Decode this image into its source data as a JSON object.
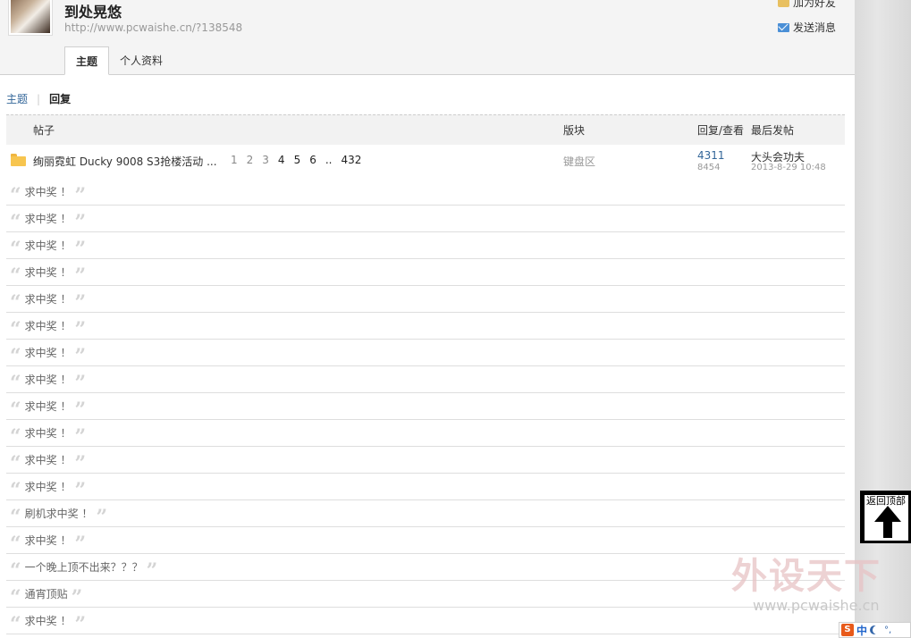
{
  "profile": {
    "username": "到处晃悠",
    "url": "http://www.pcwaishe.cn/?138548",
    "actions": {
      "add_friend": "加为好友",
      "send_message": "发送消息"
    }
  },
  "tabs": [
    {
      "label": "主题",
      "active": true
    },
    {
      "label": "个人资料",
      "active": false
    }
  ],
  "subnav": {
    "topics": "主题",
    "replies": "回复"
  },
  "table": {
    "headers": {
      "post": "帖子",
      "forum": "版块",
      "stats": "回复/查看",
      "last": "最后发帖"
    },
    "thread": {
      "title": "绚丽霓虹 Ducky 9008 S3抢楼活动 ...",
      "pages": [
        "1",
        "2",
        "3",
        "4",
        "5",
        "6",
        "..",
        "432"
      ],
      "forum": "键盘区",
      "replies": "4311",
      "views": "8454",
      "last_poster": "大头会功夫",
      "last_date": "2013-8-29 10:48"
    },
    "reply_rows": [
      "求中奖 ！",
      "求中奖 ！",
      "求中奖 ！",
      "求中奖 ！",
      "求中奖 ！",
      "求中奖 ！",
      "求中奖 ！",
      "求中奖 ！",
      "求中奖 ！",
      "求中奖 ！",
      "求中奖 ！",
      "求中奖 ！",
      "刷机求中奖 ！",
      "求中奖 ！",
      "一个晚上顶不出来？？？",
      "通宵顶贴",
      "求中奖 ！"
    ]
  },
  "back_to_top": "返回顶部",
  "watermark": {
    "brand": "外设天下",
    "url": "www.pcwaishe.cn"
  },
  "ime": {
    "logo": "S",
    "mode": "中",
    "punct": "°,"
  },
  "colors": {
    "link": "#336699",
    "header_bg": "#f4f4f4",
    "folder": "#f7c54f"
  }
}
